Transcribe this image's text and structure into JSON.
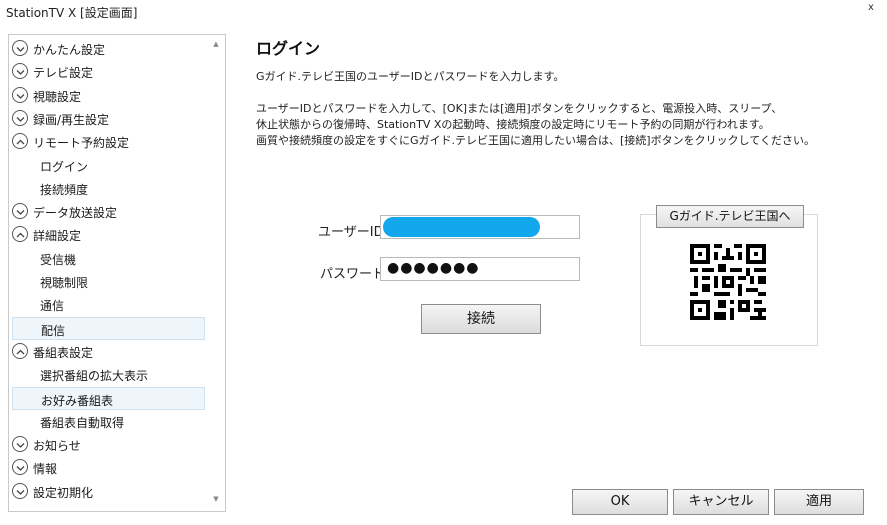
{
  "window": {
    "title": "StationTV X [設定画面]",
    "close_label": "x"
  },
  "sidebar": {
    "items": [
      {
        "label": "かんたん設定",
        "level": "top",
        "state": "collapsed"
      },
      {
        "label": "テレビ設定",
        "level": "top",
        "state": "collapsed"
      },
      {
        "label": "視聴設定",
        "level": "top",
        "state": "collapsed"
      },
      {
        "label": "録画/再生設定",
        "level": "top",
        "state": "collapsed"
      },
      {
        "label": "リモート予約設定",
        "level": "top",
        "state": "expanded"
      },
      {
        "label": "ログイン",
        "level": "child"
      },
      {
        "label": "接続頻度",
        "level": "child"
      },
      {
        "label": "データ放送設定",
        "level": "top",
        "state": "collapsed"
      },
      {
        "label": "詳細設定",
        "level": "top",
        "state": "expanded"
      },
      {
        "label": "受信機",
        "level": "child"
      },
      {
        "label": "視聴制限",
        "level": "child"
      },
      {
        "label": "通信",
        "level": "child"
      },
      {
        "label": "配信",
        "level": "child",
        "selected": true
      },
      {
        "label": "番組表設定",
        "level": "top",
        "state": "expanded"
      },
      {
        "label": "選択番組の拡大表示",
        "level": "child"
      },
      {
        "label": "お好み番組表",
        "level": "child",
        "selected": true
      },
      {
        "label": "番組表自動取得",
        "level": "child"
      },
      {
        "label": "お知らせ",
        "level": "top",
        "state": "collapsed"
      },
      {
        "label": "情報",
        "level": "top",
        "state": "collapsed"
      },
      {
        "label": "設定初期化",
        "level": "top",
        "state": "collapsed"
      }
    ]
  },
  "main": {
    "title": "ログイン",
    "intro": "Gガイド.テレビ王国のユーザーIDとパスワードを入力します。",
    "desc_lines": [
      "ユーザーIDとパスワードを入力して、[OK]または[適用]ボタンをクリックすると、電源投入時、スリープ、",
      "休止状態からの復帰時、StationTV Xの起動時、接続頻度の設定時にリモート予約の同期が行われます。",
      "画質や接続頻度の設定をすぐにGガイド.テレビ王国に適用したい場合は、[接続]ボタンをクリックしてください。"
    ],
    "user_id_label": "ユーザーID:",
    "password_label": "パスワード:",
    "password_value": "●●●●●●●",
    "connect_label": "接続",
    "qr_button_label": "Gガイド.テレビ王国へ"
  },
  "footer": {
    "ok_label": "OK",
    "cancel_label": "キャンセル",
    "apply_label": "適用"
  },
  "colors": {
    "redaction": "#12a7ec",
    "selected_bg": "#eef5fb"
  }
}
